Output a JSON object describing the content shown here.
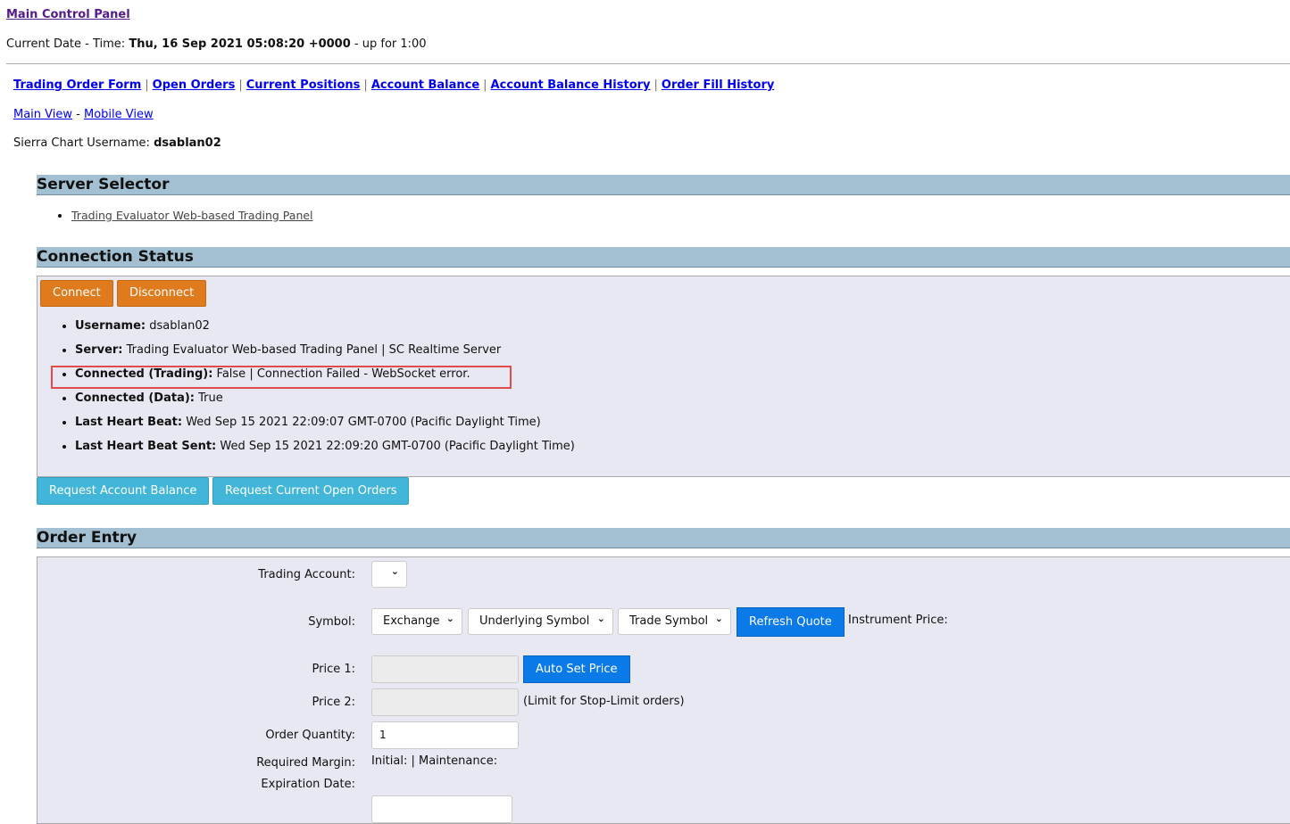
{
  "header": {
    "title": "Main Control Panel",
    "date_label": "Current Date - Time:",
    "date_value": "Thu, 16 Sep 2021 05:08:20 +0000",
    "uptime": "- up for 1:00"
  },
  "nav": {
    "links": [
      "Trading Order Form",
      "Open Orders",
      "Current Positions",
      "Account Balance",
      "Account Balance History",
      "Order Fill History"
    ],
    "separator": "|"
  },
  "views": {
    "main": "Main View",
    "dash": "-",
    "mobile": "Mobile View"
  },
  "user": {
    "label": "Sierra Chart Username:",
    "value": "dsablan02"
  },
  "server_selector": {
    "title": "Server Selector",
    "items": [
      "Trading Evaluator Web-based Trading Panel"
    ]
  },
  "connection": {
    "title": "Connection Status",
    "connect": "Connect",
    "disconnect": "Disconnect",
    "rows": [
      {
        "label": "Username:",
        "value": "dsablan02"
      },
      {
        "label": "Server:",
        "value": "Trading Evaluator Web-based Trading Panel | SC Realtime Server"
      },
      {
        "label": "Connected (Trading):",
        "value": "False | Connection Failed - WebSocket error."
      },
      {
        "label": "Connected (Data):",
        "value": "True"
      },
      {
        "label": "Last Heart Beat:",
        "value": "Wed Sep 15 2021 22:09:07 GMT-0700 (Pacific Daylight Time)"
      },
      {
        "label": "Last Heart Beat Sent:",
        "value": "Wed Sep 15 2021 22:09:20 GMT-0700 (Pacific Daylight Time)"
      }
    ],
    "request_balance": "Request Account Balance",
    "request_orders": "Request Current Open Orders"
  },
  "order_entry": {
    "title": "Order Entry",
    "trading_account": "Trading Account:",
    "symbol": "Symbol:",
    "exchange": "Exchange",
    "underlying": "Underlying Symbol",
    "trade_symbol": "Trade Symbol",
    "refresh_quote": "Refresh Quote",
    "instrument_price": "Instrument Price:",
    "price1": "Price 1:",
    "auto_set_price": "Auto Set Price",
    "price2": "Price 2:",
    "price2_note": "(Limit for Stop-Limit orders)",
    "order_quantity": "Order Quantity:",
    "quantity_value": "1",
    "required_margin": "Required Margin:",
    "margin_value": "Initial: | Maintenance:",
    "expiration_date": "Expiration Date:"
  },
  "colors": {
    "orange": "#e07b1d",
    "cyan": "#41b6d8",
    "blue": "#0a7ae8",
    "section": "#a3bfd2"
  }
}
